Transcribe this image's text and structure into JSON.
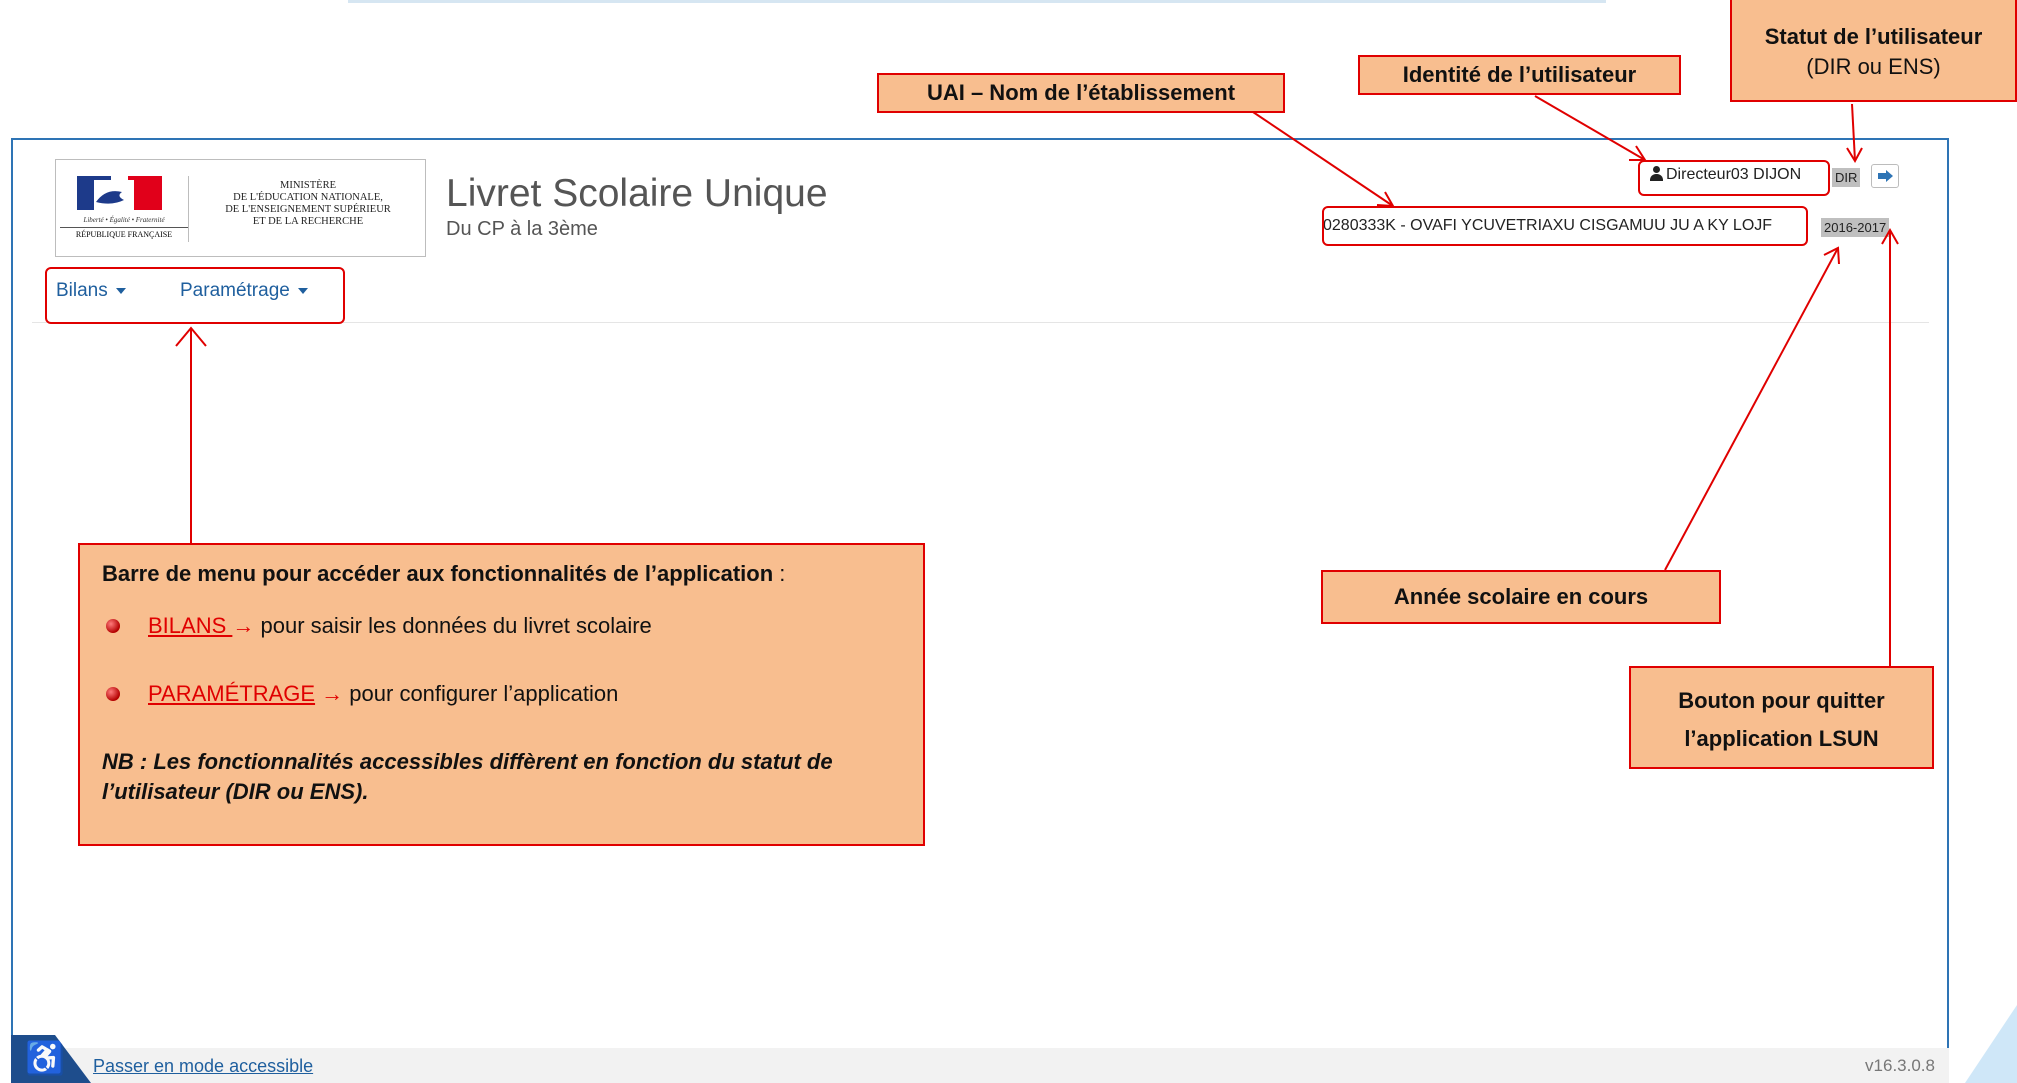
{
  "header": {
    "ministry_lines": [
      "MINISTÈRE",
      "DE L'ÉDUCATION NATIONALE,",
      "DE L'ENSEIGNEMENT SUPÉRIEUR",
      "ET DE LA RECHERCHE"
    ],
    "motto": "Liberté • Égalité • Fraternité",
    "republic": "RÉPUBLIQUE FRANÇAISE",
    "app_title": "Livret Scolaire Unique",
    "app_subtitle": "Du CP à la 3ème"
  },
  "nav": {
    "items": [
      {
        "label": "Bilans"
      },
      {
        "label": "Paramétrage"
      }
    ]
  },
  "user": {
    "name": "Directeur03 DIJON",
    "status": "DIR",
    "school": "0280333K - OVAFI YCUVETRIAXU CISGAMUU JU A KY LOJF",
    "year": "2016-2017"
  },
  "footer": {
    "accessible_link": "Passer en mode accessible",
    "version": "v16.3.0.8"
  },
  "annotations": {
    "uai": "UAI – Nom de l’établissement",
    "identity": "Identité de l’utilisateur",
    "status_title": "Statut de l’utilisateur",
    "status_sub": "(DIR ou ENS)",
    "year": "Année scolaire en cours",
    "quit_line1": "Bouton pour quitter",
    "quit_line2": "l’application LSUN",
    "menu_title": "Barre de menu pour accéder aux fonctionnalités de l’application",
    "menu_colon": " :",
    "bilans_link": "BILANS ",
    "bilans_arrow": "→",
    "bilans_text": " pour saisir les données du livret scolaire",
    "param_link": "PARAMÉTRAGE",
    "param_arrow": " →",
    "param_text": " pour configurer l’application",
    "note": "NB : Les fonctionnalités accessibles diffèrent en fonction du statut de l’utilisateur (DIR ou ENS)."
  },
  "colors": {
    "callout_fill": "#f8be8f",
    "annotation_red": "#e00000",
    "frame_blue": "#2e74b5",
    "link_blue": "#1f5f9e"
  }
}
